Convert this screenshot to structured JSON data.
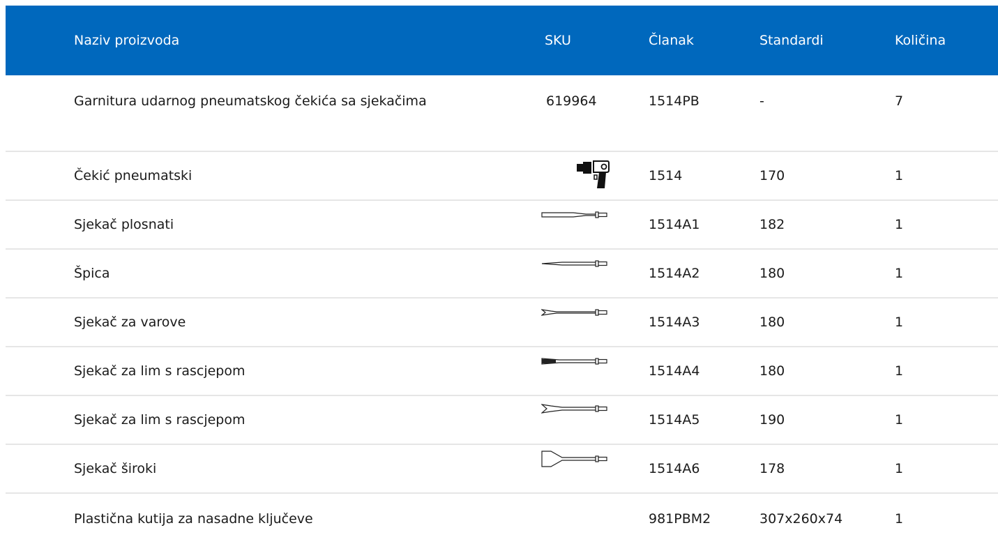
{
  "header": {
    "name": "Naziv proizvoda",
    "sku": "SKU",
    "article": "Članak",
    "standards": "Standardi",
    "quantity": "Količina"
  },
  "rows": [
    {
      "name": "Garnitura udarnog pneumatskog čekića sa sjekačima",
      "sku": "619964",
      "article": "1514PB",
      "standards": "-",
      "quantity": "7",
      "icon": null
    },
    {
      "name": "Čekić pneumatski",
      "sku": "",
      "article": "1514",
      "standards": "170",
      "quantity": "1",
      "icon": "air-hammer-icon"
    },
    {
      "name": "Sjekač plosnati",
      "sku": "",
      "article": "1514A1",
      "standards": "182",
      "quantity": "1",
      "icon": "flat-chisel-icon"
    },
    {
      "name": "Špica",
      "sku": "",
      "article": "1514A2",
      "standards": "180",
      "quantity": "1",
      "icon": "point-chisel-icon"
    },
    {
      "name": "Sjekač za varove",
      "sku": "",
      "article": "1514A3",
      "standards": "180",
      "quantity": "1",
      "icon": "weld-chisel-icon"
    },
    {
      "name": "Sjekač za lim s rascjepom",
      "sku": "",
      "article": "1514A4",
      "standards": "180",
      "quantity": "1",
      "icon": "panel-cutter-icon"
    },
    {
      "name": "Sjekač za lim s rascjepom",
      "sku": "",
      "article": "1514A5",
      "standards": "190",
      "quantity": "1",
      "icon": "split-panel-cutter-icon"
    },
    {
      "name": "Sjekač široki",
      "sku": "",
      "article": "1514A6",
      "standards": "178",
      "quantity": "1",
      "icon": "wide-chisel-icon"
    },
    {
      "name": "Plastična kutija za nasadne ključeve",
      "sku": "",
      "article": "981PBM2",
      "standards": "307x260x74",
      "quantity": "1",
      "icon": null
    }
  ],
  "colors": {
    "header_bg": "#0068bd",
    "header_text": "#ffffff",
    "row_divider": "#e6e6e6"
  }
}
